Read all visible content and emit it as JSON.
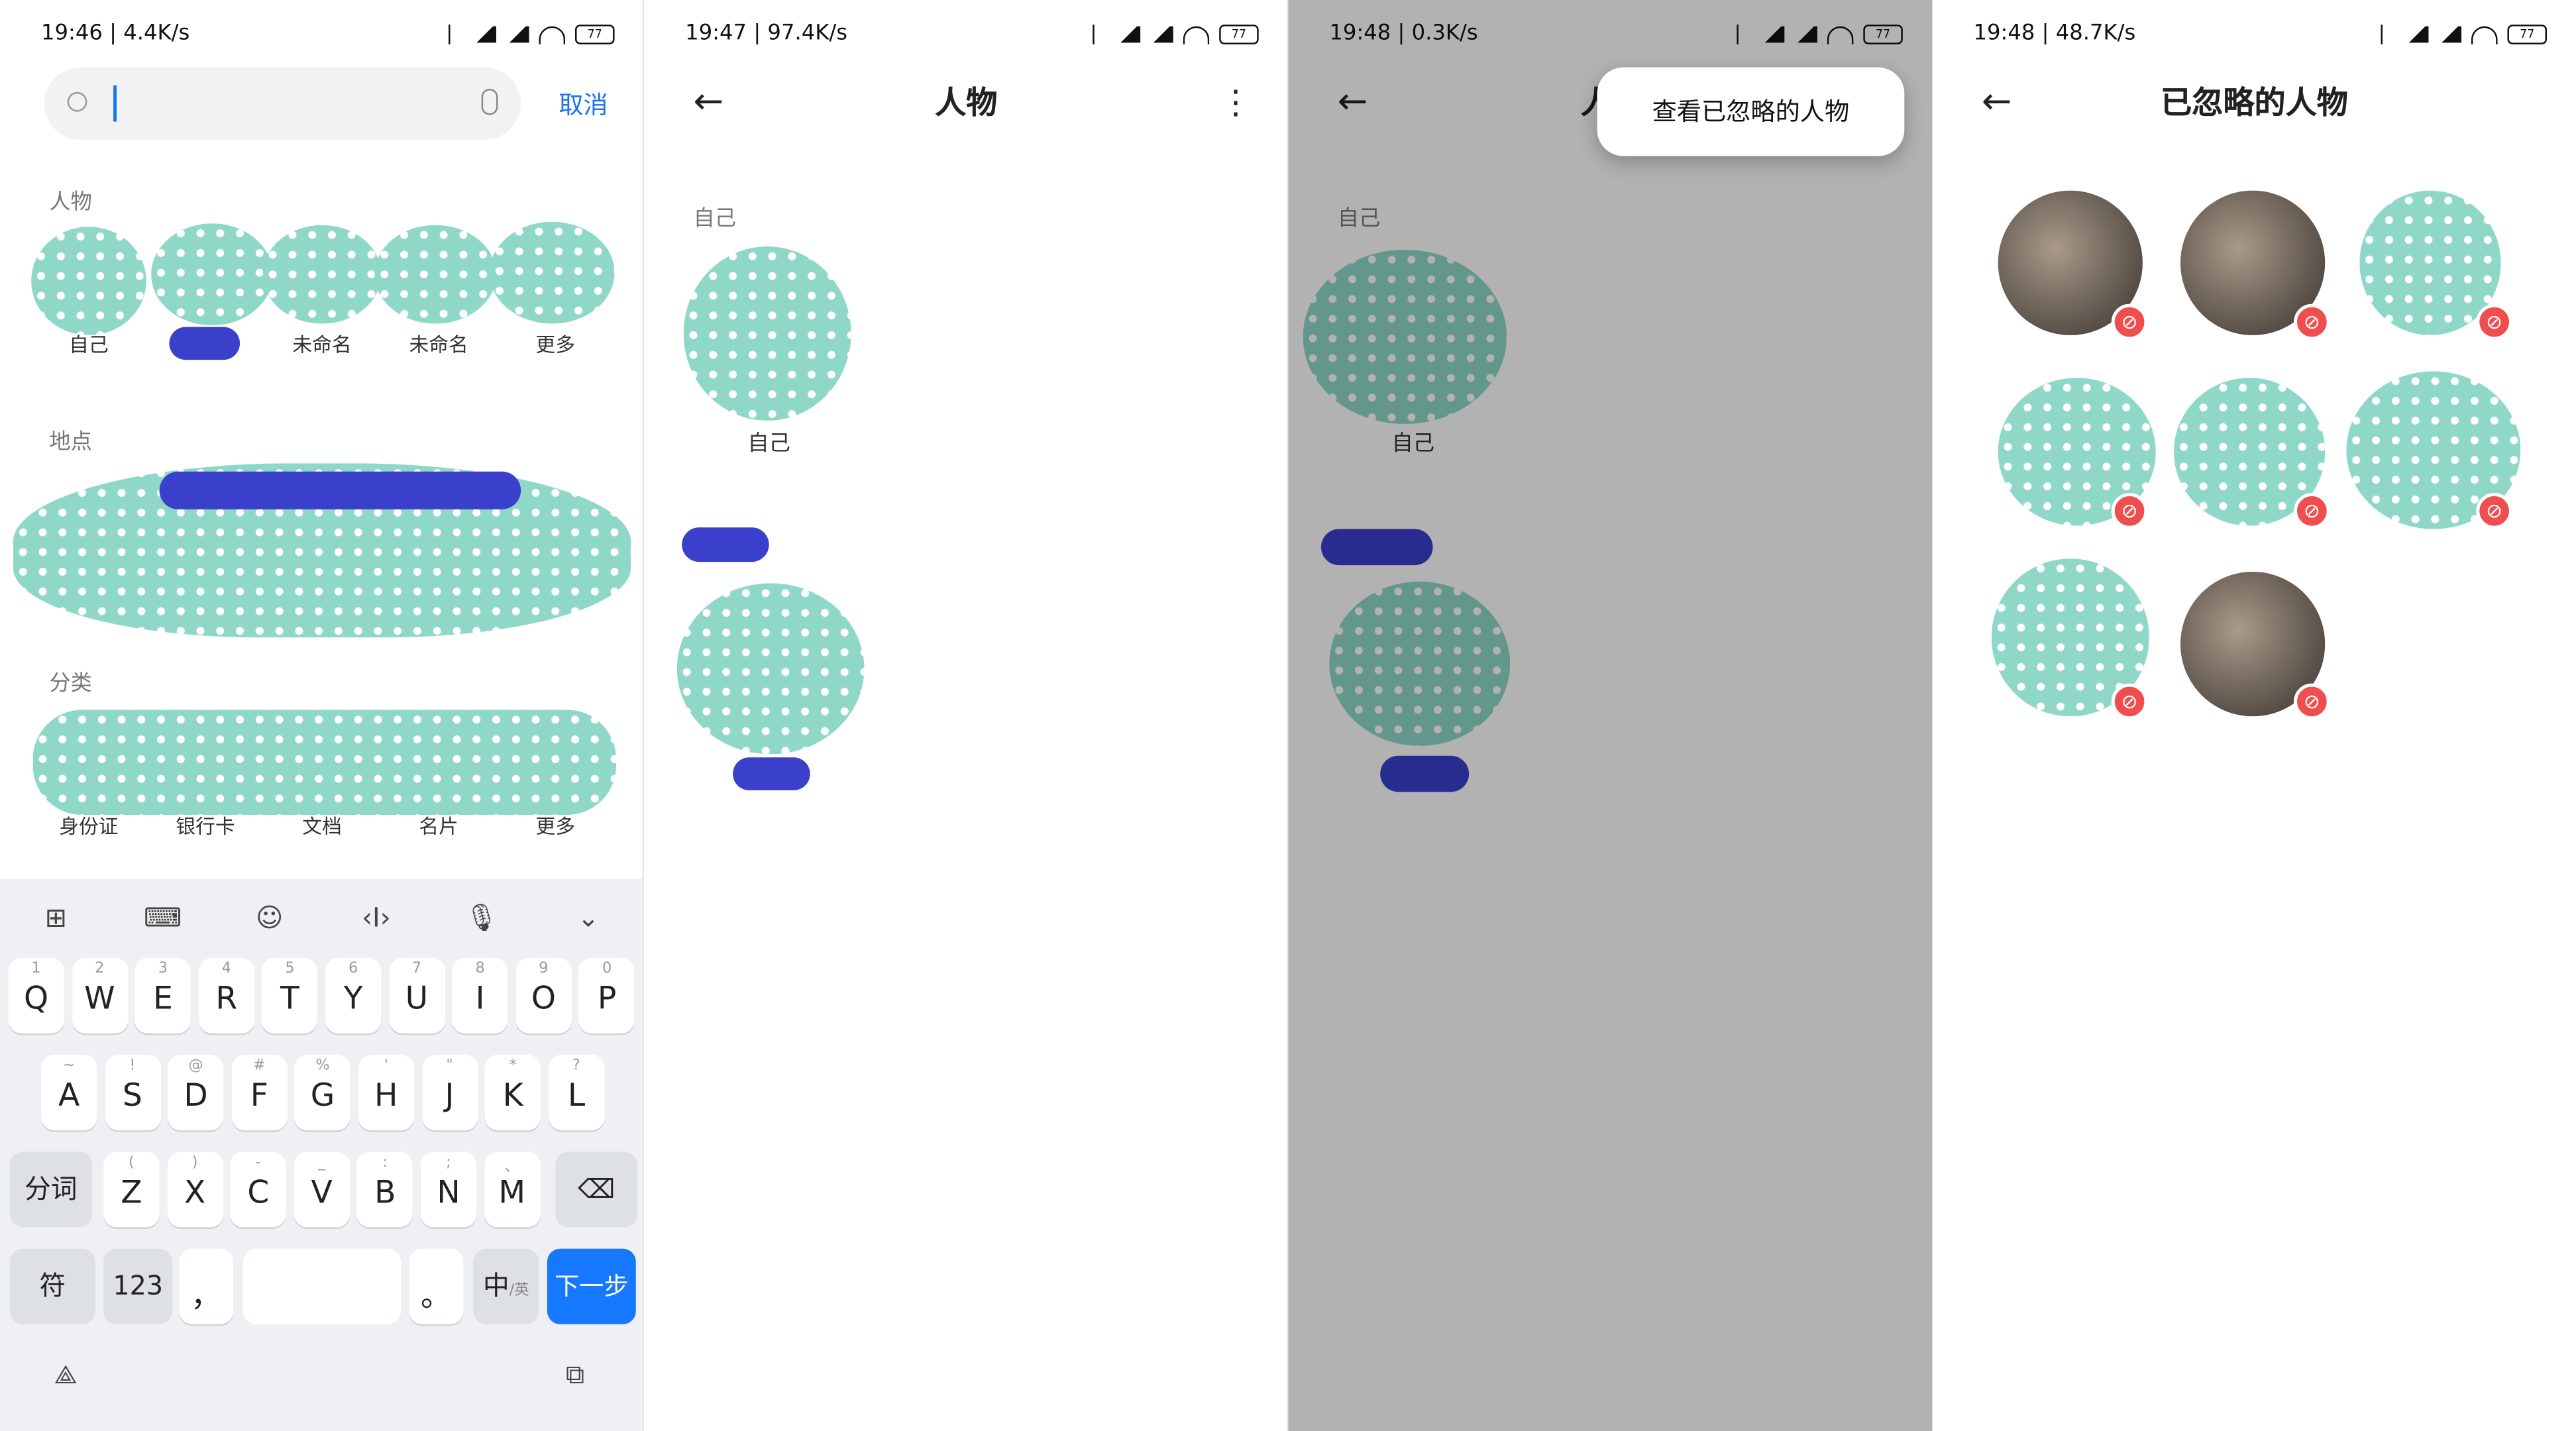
{
  "colors": {
    "accent": "#1a73e8",
    "blob": "#8fd8c8",
    "scribble": "#3a40cc",
    "ignore_badge": "#f04e4e"
  },
  "panels": [
    {
      "status": {
        "time": "19:46 | 4.4K/s",
        "battery": "77"
      },
      "search": {
        "placeholder": "",
        "cancel": "取消"
      },
      "people": {
        "title": "人物",
        "labels": [
          "自己",
          "",
          "未命名",
          "未命名",
          "更多"
        ]
      },
      "places": {
        "title": "地点"
      },
      "categories": {
        "title": "分类",
        "labels": [
          "身份证",
          "银行卡",
          "文档",
          "名片",
          "更多"
        ]
      },
      "keyboard": {
        "tools": [
          "grid-icon",
          "keyboard-icon",
          "emoji-icon",
          "cursor-icon",
          "mic-icon",
          "collapse-icon"
        ],
        "row1": [
          [
            "Q",
            "1"
          ],
          [
            "W",
            "2"
          ],
          [
            "E",
            "3"
          ],
          [
            "R",
            "4"
          ],
          [
            "T",
            "5"
          ],
          [
            "Y",
            "6"
          ],
          [
            "U",
            "7"
          ],
          [
            "I",
            "8"
          ],
          [
            "O",
            "9"
          ],
          [
            "P",
            "0"
          ]
        ],
        "row2": [
          [
            "A",
            "~"
          ],
          [
            "S",
            "!"
          ],
          [
            "D",
            "@"
          ],
          [
            "F",
            "#"
          ],
          [
            "G",
            "%"
          ],
          [
            "H",
            "'"
          ],
          [
            "J",
            "\""
          ],
          [
            "K",
            "*"
          ],
          [
            "L",
            "?"
          ]
        ],
        "row3_left": "分词",
        "row3": [
          [
            "Z",
            "("
          ],
          [
            "X",
            ")"
          ],
          [
            "C",
            "-"
          ],
          [
            "V",
            "_"
          ],
          [
            "B",
            ":"
          ],
          [
            "N",
            ";"
          ],
          [
            "M",
            "、"
          ]
        ],
        "sym": "符",
        "num": "123",
        "comma": "，",
        "period": "。",
        "lang": "中",
        "lang_sub": "/英",
        "next": "下一步"
      }
    },
    {
      "status": {
        "time": "19:47 | 97.4K/s",
        "battery": "77"
      },
      "title": "人物",
      "section": "自己",
      "self_label": "自己"
    },
    {
      "status": {
        "time": "19:48 | 0.3K/s",
        "battery": "77"
      },
      "title": "人",
      "section": "自己",
      "self_label": "自己",
      "popup": "查看已忽略的人物"
    },
    {
      "status": {
        "time": "19:48 | 48.7K/s",
        "battery": "77"
      },
      "title": "已忽略的人物"
    }
  ]
}
